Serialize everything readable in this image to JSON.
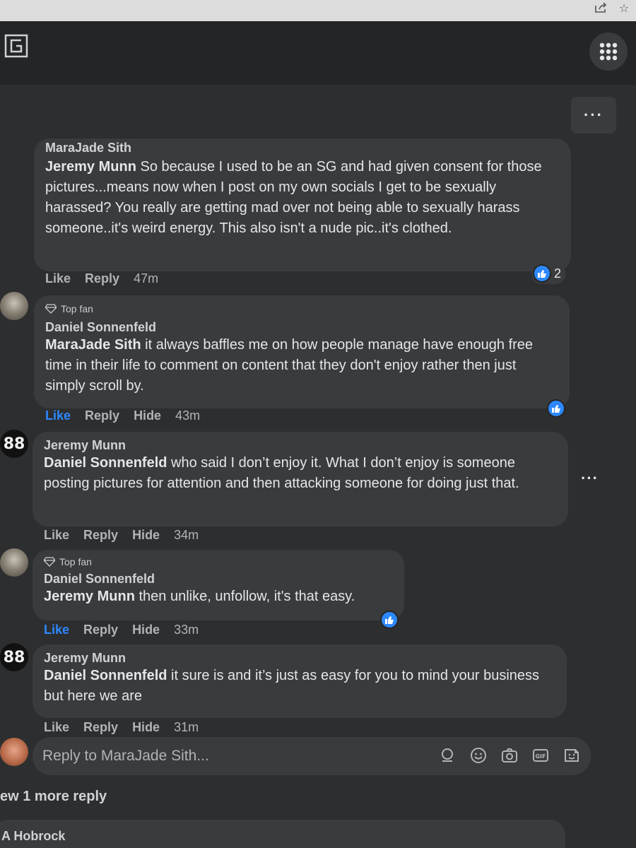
{
  "topbar": {
    "logo_icon": "gaming-logo-icon",
    "apps_icon": "grid-menu-icon"
  },
  "more_top_label": "···",
  "comments": [
    {
      "author": "MaraJade Sith",
      "mention": "Jeremy Munn",
      "text": " So because I used to be an SG and had given consent for those pictures...means now when I post on my own socials I get to be sexually harassed? You really are getting mad over not being able to sexually harass someone..it's weird energy. This also isn't a nude pic..it's clothed.",
      "actions": {
        "like": "Like",
        "reply": "Reply",
        "time": "47m"
      },
      "reaction_count": "2"
    },
    {
      "badge": "Top fan",
      "author": "Daniel Sonnenfeld",
      "mention": "MaraJade Sith",
      "text": " it always baffles me on how people manage have enough free time in their life to comment on content that they don't enjoy rather then just simply scroll by.",
      "actions": {
        "like": "Like",
        "reply": "Reply",
        "hide": "Hide",
        "time": "43m"
      }
    },
    {
      "author": "Jeremy Munn",
      "mention": "Daniel Sonnenfeld",
      "text": " who said I don’t enjoy it. What I don’t enjoy is someone posting pictures for attention and then attacking someone for doing just that.",
      "actions": {
        "like": "Like",
        "reply": "Reply",
        "hide": "Hide",
        "time": "34m"
      },
      "avatar_text": "88"
    },
    {
      "badge": "Top fan",
      "author": "Daniel Sonnenfeld",
      "mention": "Jeremy Munn",
      "text": " then unlike, unfollow, it's that easy.",
      "actions": {
        "like": "Like",
        "reply": "Reply",
        "hide": "Hide",
        "time": "33m"
      }
    },
    {
      "author": "Jeremy Munn",
      "mention": "Daniel Sonnenfeld",
      "text": " it sure is and it’s just as easy for you to mind your business but here we are",
      "actions": {
        "like": "Like",
        "reply": "Reply",
        "hide": "Hide",
        "time": "31m"
      },
      "avatar_text": "88"
    }
  ],
  "reply_box": {
    "placeholder": "Reply to MaraJade Sith...",
    "icons": [
      "avatar-sticker-icon",
      "emoji-icon",
      "camera-icon",
      "gif-icon",
      "sticker-icon"
    ]
  },
  "view_more": "ew 1 more reply",
  "next_author": "A Hobrock",
  "colors": {
    "accent": "#2d88ff",
    "bubble": "#3a3b3c",
    "background": "#2d2e30"
  }
}
